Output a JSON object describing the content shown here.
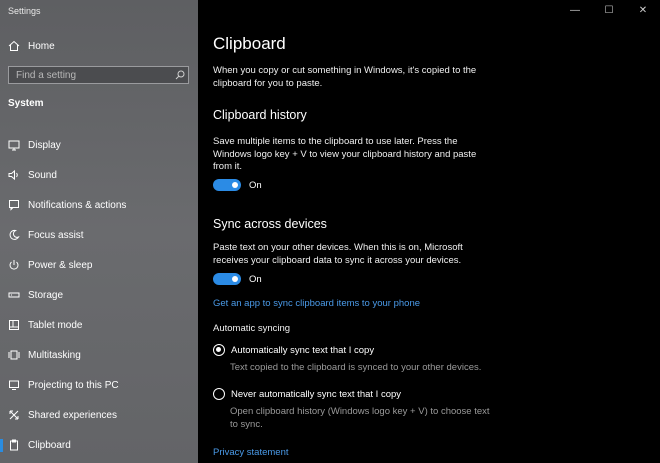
{
  "window": {
    "title": "Settings",
    "minimize": "—",
    "maximize": "☐",
    "close": "✕"
  },
  "sidebar": {
    "home": "Home",
    "search": {
      "placeholder": "Find a setting"
    },
    "section": "System",
    "items": [
      {
        "label": "Display",
        "icon": "display-icon"
      },
      {
        "label": "Sound",
        "icon": "sound-icon"
      },
      {
        "label": "Notifications & actions",
        "icon": "notifications-icon"
      },
      {
        "label": "Focus assist",
        "icon": "focus-assist-icon"
      },
      {
        "label": "Power & sleep",
        "icon": "power-icon"
      },
      {
        "label": "Storage",
        "icon": "storage-icon"
      },
      {
        "label": "Tablet mode",
        "icon": "tablet-mode-icon"
      },
      {
        "label": "Multitasking",
        "icon": "multitasking-icon"
      },
      {
        "label": "Projecting to this PC",
        "icon": "projecting-icon"
      },
      {
        "label": "Shared experiences",
        "icon": "shared-experiences-icon"
      },
      {
        "label": "Clipboard",
        "icon": "clipboard-icon",
        "active": true
      }
    ]
  },
  "main": {
    "title": "Clipboard",
    "intro": "When you copy or cut something in Windows, it's copied to the clipboard for you to paste.",
    "history": {
      "heading": "Clipboard history",
      "description": "Save multiple items to the clipboard to use later. Press the Windows logo key + V to view your clipboard history and paste from it.",
      "toggle_state": "On"
    },
    "sync": {
      "heading": "Sync across devices",
      "description": "Paste text on your other devices. When this is on, Microsoft receives your clipboard data to sync it across your devices.",
      "toggle_state": "On",
      "link": "Get an app to sync clipboard items to your phone",
      "auto_label": "Automatic syncing",
      "options": [
        {
          "label": "Automatically sync text that I copy",
          "description": "Text copied to the clipboard is synced to your other devices.",
          "checked": true
        },
        {
          "label": "Never automatically sync text that I copy",
          "description": "Open clipboard history (Windows logo key + V) to choose text to sync.",
          "checked": false
        }
      ]
    },
    "privacy": "Privacy statement"
  },
  "colors": {
    "accent": "#2b8be5",
    "link": "#4a9ae8",
    "sidebar_bg": "#636467",
    "main_bg": "#000000"
  }
}
